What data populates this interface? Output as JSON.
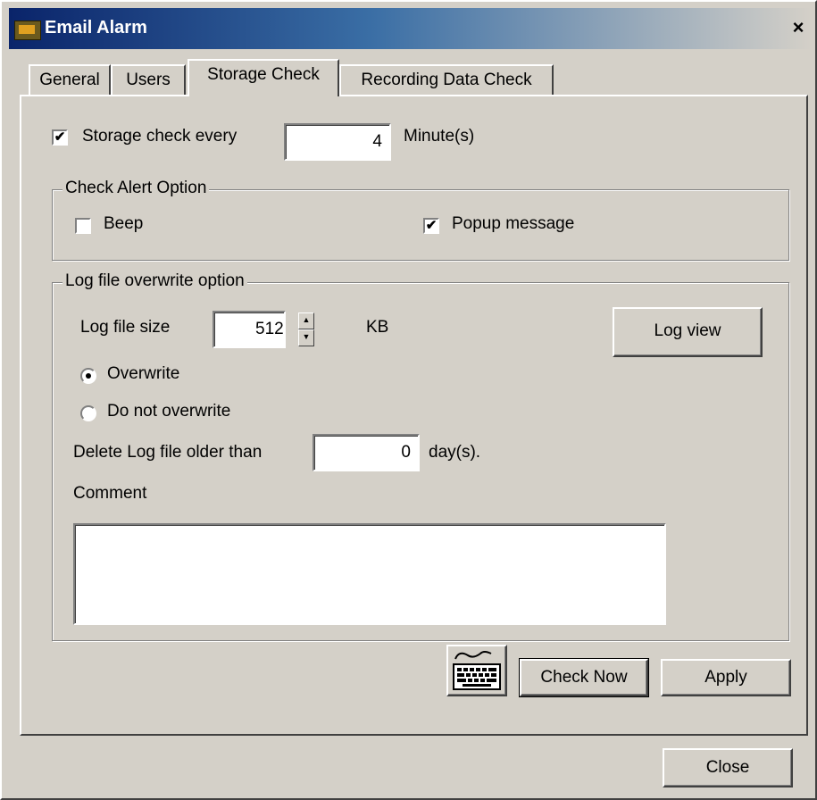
{
  "window": {
    "title": "Email Alarm",
    "close_glyph": "×"
  },
  "tabs": [
    {
      "label": "General"
    },
    {
      "label": "Users"
    },
    {
      "label": "Storage Check",
      "active": true
    },
    {
      "label": "Recording Data Check"
    }
  ],
  "storage_check": {
    "label": "Storage check every",
    "checked": true,
    "value": "4",
    "unit": "Minute(s)"
  },
  "alert_option": {
    "title": "Check Alert Option",
    "beep": {
      "label": "Beep",
      "checked": false
    },
    "popup": {
      "label": "Popup message",
      "checked": true
    }
  },
  "log_option": {
    "title": "Log file overwrite option",
    "size_label": "Log file size",
    "size_value": "512",
    "size_unit": "KB",
    "log_view_label": "Log view",
    "overwrite_label": "Overwrite",
    "no_overwrite_label": "Do not overwrite",
    "selected": "overwrite",
    "delete_label": "Delete Log file older than",
    "delete_value": "0",
    "delete_unit": "day(s).",
    "comment_label": "Comment",
    "comment_value": ""
  },
  "buttons": {
    "check_now": "Check Now",
    "apply": "Apply",
    "close": "Close"
  },
  "icons": {
    "keyboard": "keyboard-icon",
    "app": "email-alarm-icon"
  }
}
